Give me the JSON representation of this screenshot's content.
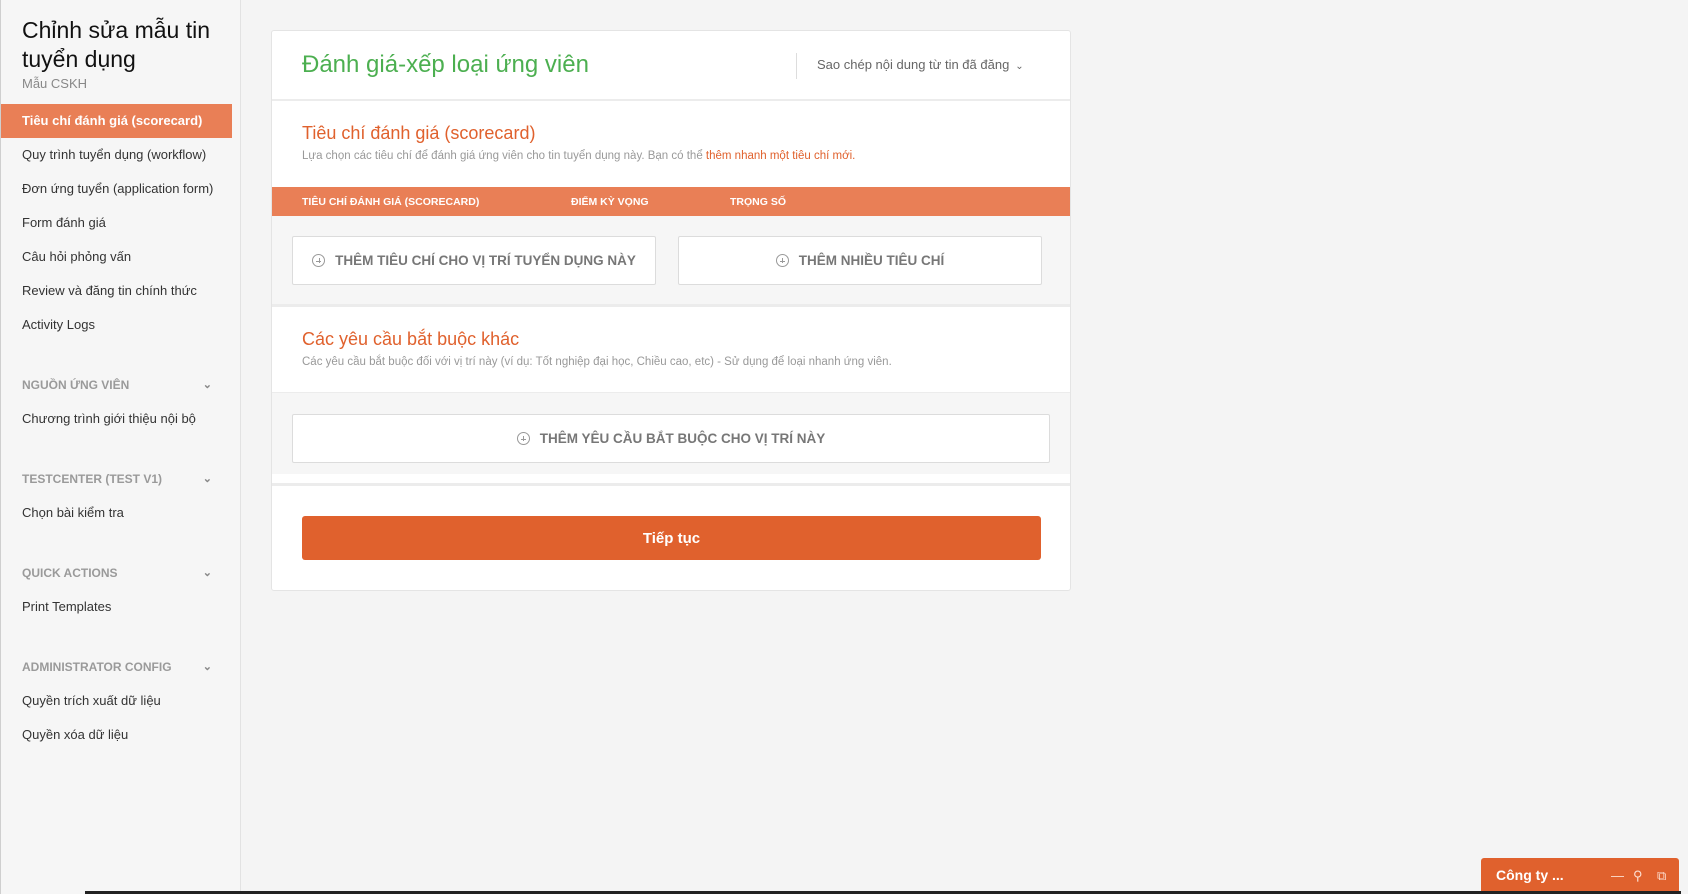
{
  "sidebar": {
    "title": "Chỉnh sửa mẫu tin tuyển dụng",
    "subtitle": "Mẫu CSKH",
    "items": [
      {
        "label": "Tiêu chí đánh giá (scorecard)",
        "active": true
      },
      {
        "label": "Quy trình tuyển dụng (workflow)"
      },
      {
        "label": "Đơn ứng tuyển (application form)"
      },
      {
        "label": "Form đánh giá"
      },
      {
        "label": "Câu hỏi phỏng vấn"
      },
      {
        "label": "Review và đăng tin chính thức"
      },
      {
        "label": "Activity Logs"
      }
    ],
    "groups": [
      {
        "header": "NGUỒN ỨNG VIÊN",
        "items": [
          "Chương trình giới thiệu nội bộ"
        ]
      },
      {
        "header": "TESTCENTER (TEST V1)",
        "items": [
          "Chọn bài kiểm tra"
        ]
      },
      {
        "header": "QUICK ACTIONS",
        "items": [
          "Print Templates"
        ]
      },
      {
        "header": "ADMINISTRATOR CONFIG",
        "items": [
          "Quyền trích xuất dữ liệu",
          "Quyền xóa dữ liệu"
        ]
      }
    ]
  },
  "main": {
    "title": "Đánh giá-xếp loại ứng viên",
    "copy_dropdown": "Sao chép nội dung từ tin đã đăng",
    "scorecard": {
      "title": "Tiêu chí đánh giá (scorecard)",
      "desc": "Lựa chọn các tiêu chí để đánh giá ứng viên cho tin tuyển dụng này. Bạn có thể",
      "link": "thêm nhanh một tiêu chí mới.",
      "columns": [
        "TIÊU CHÍ ĐÁNH GIÁ (SCORECARD)",
        "ĐIỂM KỲ VỌNG",
        "TRỌNG SỐ"
      ],
      "add_one_label": "THÊM TIÊU CHÍ CHO VỊ TRÍ TUYỂN DỤNG NÀY",
      "add_many_label": "THÊM NHIỀU TIÊU CHÍ"
    },
    "requirements": {
      "title": "Các yêu cầu bắt buộc khác",
      "desc": "Các yêu cầu bắt buộc đối với vị trí này (ví dụ: Tốt nghiệp đại học, Chiều cao, etc) - Sử dụng để loại nhanh ứng viên.",
      "add_label": "THÊM YÊU CẦU BẮT BUỘC CHO VỊ TRÍ NÀY"
    },
    "continue_label": "Tiếp tục"
  },
  "chat": {
    "label": "Công ty ...",
    "icons": [
      "minimize-icon",
      "search-icon",
      "popout-icon"
    ]
  },
  "colors": {
    "accent": "#e0612d",
    "accent_light": "#e97f56",
    "title_green": "#4caf50"
  }
}
